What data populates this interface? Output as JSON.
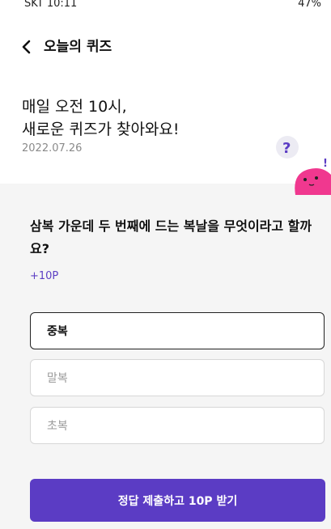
{
  "status_bar": {
    "carrier_time": "SKT 10:11",
    "battery": "47%"
  },
  "header": {
    "title": "오늘의 퀴즈"
  },
  "intro": {
    "line1": "매일 오전 10시,",
    "line2": "새로운 퀴즈가 찾아와요!",
    "date": "2022.07.26"
  },
  "quiz": {
    "question": "삼복 가운데 두 번째에 드는 복날을 무엇이라고 할까요?",
    "points": "+10P",
    "options": [
      "중복",
      "말복",
      "초복"
    ],
    "selected_index": 0
  },
  "submit": {
    "label": "정답 제출하고 10P 받기"
  },
  "colors": {
    "accent": "#5b3cc4",
    "mascot_pink": "#f0388f"
  }
}
